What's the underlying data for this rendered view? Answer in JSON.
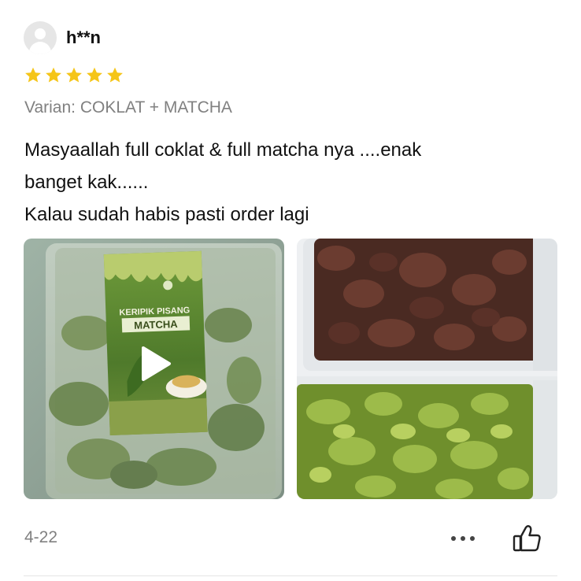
{
  "review": {
    "username": "h**n",
    "rating": 5,
    "rating_max": 5,
    "variant": "Varian: COKLAT + MATCHA",
    "text_lines": [
      "Masyaallah full coklat & full matcha nya ....enak",
      "banget kak......",
      "Kalau sudah habis pasti order lagi"
    ],
    "date": "4-22"
  },
  "media": {
    "video_package_line1": "KERIPIK PISANG",
    "video_package_line2": "MATCHA"
  },
  "icons": {
    "avatar": "user-avatar-icon",
    "star": "star-icon",
    "play": "play-icon",
    "more": "more-dots-icon",
    "like": "thumbs-up-icon"
  },
  "colors": {
    "star": "#F5C518",
    "muted_text": "#808080",
    "text": "#111111"
  }
}
